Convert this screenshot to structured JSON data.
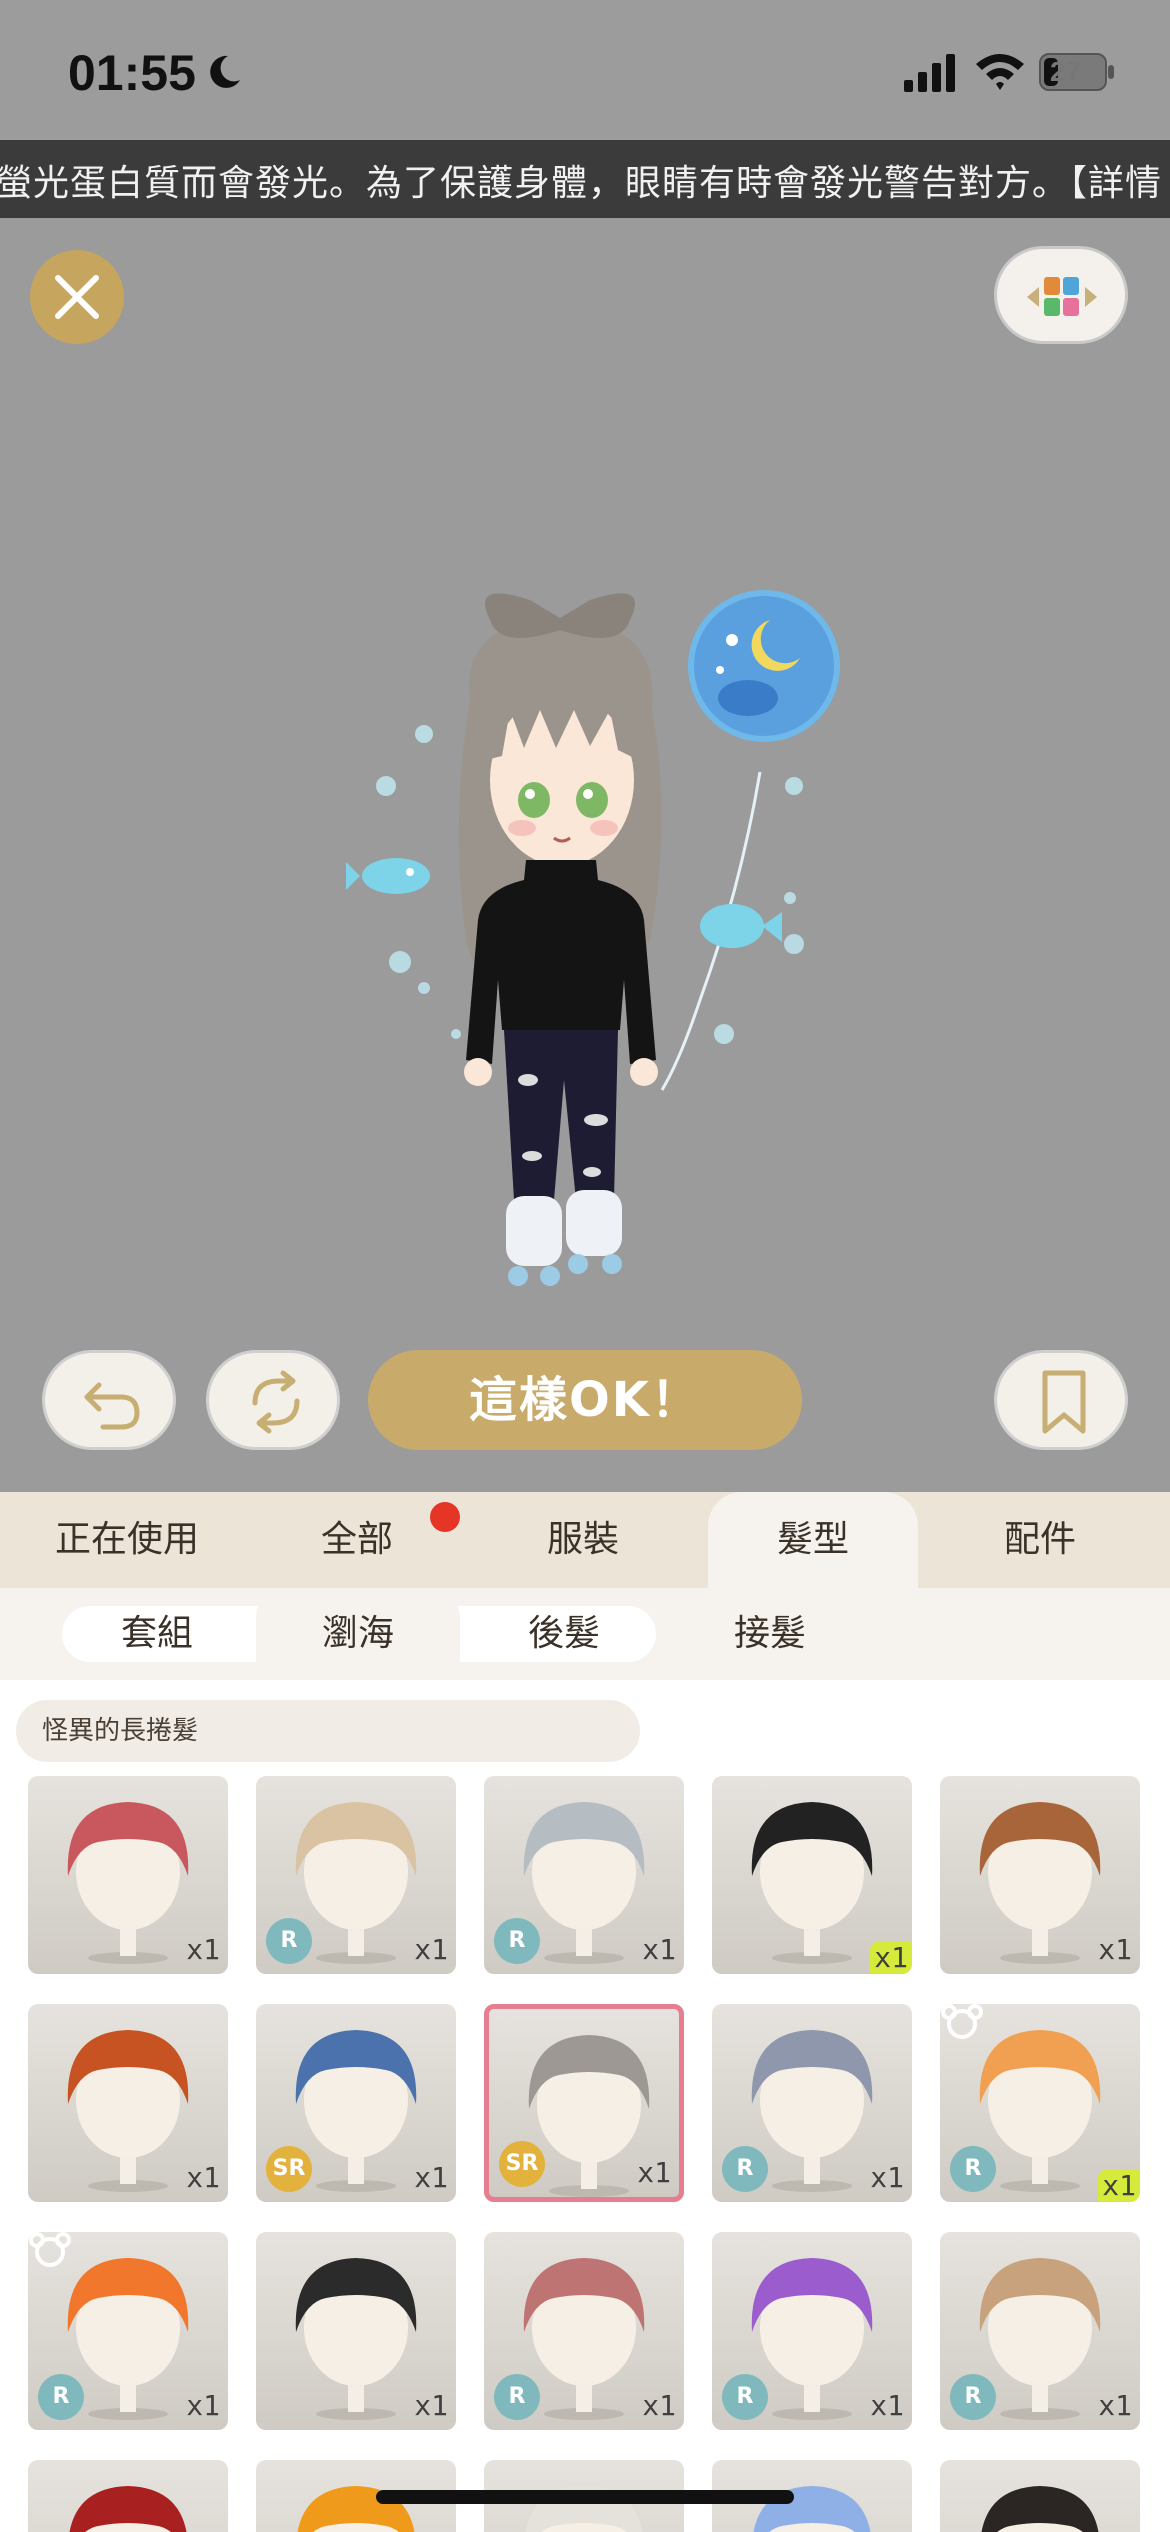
{
  "status": {
    "time": "01:55",
    "battery": "27"
  },
  "ticker": {
    "text": "螢光蛋白質而會發光。為了保護身體，眼睛有時會發光警告對方。【詳情"
  },
  "actions": {
    "ok_label": "這樣OK！"
  },
  "category_tabs": [
    "正在使用",
    "全部",
    "服裝",
    "髮型",
    "配件"
  ],
  "active_category": "髮型",
  "sub_tabs": [
    "套組",
    "瀏海",
    "後髮",
    "接髮"
  ],
  "active_sub_tab": "瀏海",
  "filter": {
    "label": "怪異的長捲髮"
  },
  "items": [
    {
      "hair": "#c9585e",
      "rarity": "",
      "qty": "x1"
    },
    {
      "hair": "#d9c3a2",
      "rarity": "R",
      "qty": "x1"
    },
    {
      "hair": "#b5bcc2",
      "rarity": "R",
      "qty": "x1"
    },
    {
      "hair": "#222222",
      "rarity": "",
      "qty": "x1",
      "qty_highlight": true
    },
    {
      "hair": "#a8653a",
      "rarity": "",
      "qty": "x1"
    },
    {
      "hair": "#c65321",
      "rarity": "",
      "qty": "x1"
    },
    {
      "hair": "#4b72ad",
      "rarity": "SR",
      "qty": "x1"
    },
    {
      "hair": "#9d9893",
      "rarity": "SR",
      "qty": "x1",
      "selected": true
    },
    {
      "hair": "#8e97ab",
      "rarity": "R",
      "qty": "x1"
    },
    {
      "hair": "#f0a050",
      "rarity": "R",
      "qty": "x1",
      "qty_highlight": true,
      "bear": true
    },
    {
      "hair": "#f0772b",
      "rarity": "R",
      "qty": "x1",
      "bear": true
    },
    {
      "hair": "#2b2b2b",
      "rarity": "",
      "qty": "x1"
    },
    {
      "hair": "#bd7472",
      "rarity": "R",
      "qty": "x1"
    },
    {
      "hair": "#9b5ccd",
      "rarity": "R",
      "qty": "x1"
    },
    {
      "hair": "#c8a27c",
      "rarity": "R",
      "qty": "x1"
    },
    {
      "hair": "#a8201f",
      "rarity": "",
      "qty": ""
    },
    {
      "hair": "#f09a1c",
      "rarity": "",
      "qty": ""
    },
    {
      "hair": "#e5e2dc",
      "rarity": "",
      "qty": ""
    },
    {
      "hair": "#8fb0e6",
      "rarity": "",
      "qty": ""
    },
    {
      "hair": "#2b2523",
      "rarity": "",
      "qty": ""
    }
  ]
}
